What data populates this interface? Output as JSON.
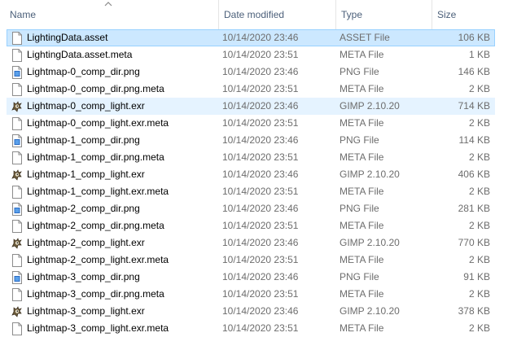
{
  "columns": {
    "name": "Name",
    "date": "Date modified",
    "type": "Type",
    "size": "Size"
  },
  "files": [
    {
      "name": "LightingData.asset",
      "date": "10/14/2020 23:46",
      "type": "ASSET File",
      "size": "106 KB",
      "icon": "blank-file-icon"
    },
    {
      "name": "LightingData.asset.meta",
      "date": "10/14/2020 23:51",
      "type": "META File",
      "size": "1 KB",
      "icon": "blank-file-icon"
    },
    {
      "name": "Lightmap-0_comp_dir.png",
      "date": "10/14/2020 23:46",
      "type": "PNG File",
      "size": "146 KB",
      "icon": "png-file-icon"
    },
    {
      "name": "Lightmap-0_comp_dir.png.meta",
      "date": "10/14/2020 23:51",
      "type": "META File",
      "size": "2 KB",
      "icon": "blank-file-icon"
    },
    {
      "name": "Lightmap-0_comp_light.exr",
      "date": "10/14/2020 23:46",
      "type": "GIMP 2.10.20",
      "size": "714 KB",
      "icon": "gimp-file-icon"
    },
    {
      "name": "Lightmap-0_comp_light.exr.meta",
      "date": "10/14/2020 23:51",
      "type": "META File",
      "size": "2 KB",
      "icon": "blank-file-icon"
    },
    {
      "name": "Lightmap-1_comp_dir.png",
      "date": "10/14/2020 23:46",
      "type": "PNG File",
      "size": "114 KB",
      "icon": "png-file-icon"
    },
    {
      "name": "Lightmap-1_comp_dir.png.meta",
      "date": "10/14/2020 23:51",
      "type": "META File",
      "size": "2 KB",
      "icon": "blank-file-icon"
    },
    {
      "name": "Lightmap-1_comp_light.exr",
      "date": "10/14/2020 23:46",
      "type": "GIMP 2.10.20",
      "size": "406 KB",
      "icon": "gimp-file-icon"
    },
    {
      "name": "Lightmap-1_comp_light.exr.meta",
      "date": "10/14/2020 23:51",
      "type": "META File",
      "size": "2 KB",
      "icon": "blank-file-icon"
    },
    {
      "name": "Lightmap-2_comp_dir.png",
      "date": "10/14/2020 23:46",
      "type": "PNG File",
      "size": "281 KB",
      "icon": "png-file-icon"
    },
    {
      "name": "Lightmap-2_comp_dir.png.meta",
      "date": "10/14/2020 23:51",
      "type": "META File",
      "size": "2 KB",
      "icon": "blank-file-icon"
    },
    {
      "name": "Lightmap-2_comp_light.exr",
      "date": "10/14/2020 23:46",
      "type": "GIMP 2.10.20",
      "size": "770 KB",
      "icon": "gimp-file-icon"
    },
    {
      "name": "Lightmap-2_comp_light.exr.meta",
      "date": "10/14/2020 23:51",
      "type": "META File",
      "size": "2 KB",
      "icon": "blank-file-icon"
    },
    {
      "name": "Lightmap-3_comp_dir.png",
      "date": "10/14/2020 23:46",
      "type": "PNG File",
      "size": "91 KB",
      "icon": "png-file-icon"
    },
    {
      "name": "Lightmap-3_comp_dir.png.meta",
      "date": "10/14/2020 23:51",
      "type": "META File",
      "size": "2 KB",
      "icon": "blank-file-icon"
    },
    {
      "name": "Lightmap-3_comp_light.exr",
      "date": "10/14/2020 23:46",
      "type": "GIMP 2.10.20",
      "size": "378 KB",
      "icon": "gimp-file-icon"
    },
    {
      "name": "Lightmap-3_comp_light.exr.meta",
      "date": "10/14/2020 23:51",
      "type": "META File",
      "size": "2 KB",
      "icon": "blank-file-icon"
    }
  ],
  "selected_index": 0,
  "hover_index": 4,
  "colors": {
    "selected_bg": "#cce8ff",
    "selected_border": "#99d1ff",
    "hover_bg": "#e5f3ff",
    "header_text": "#4c607a"
  }
}
